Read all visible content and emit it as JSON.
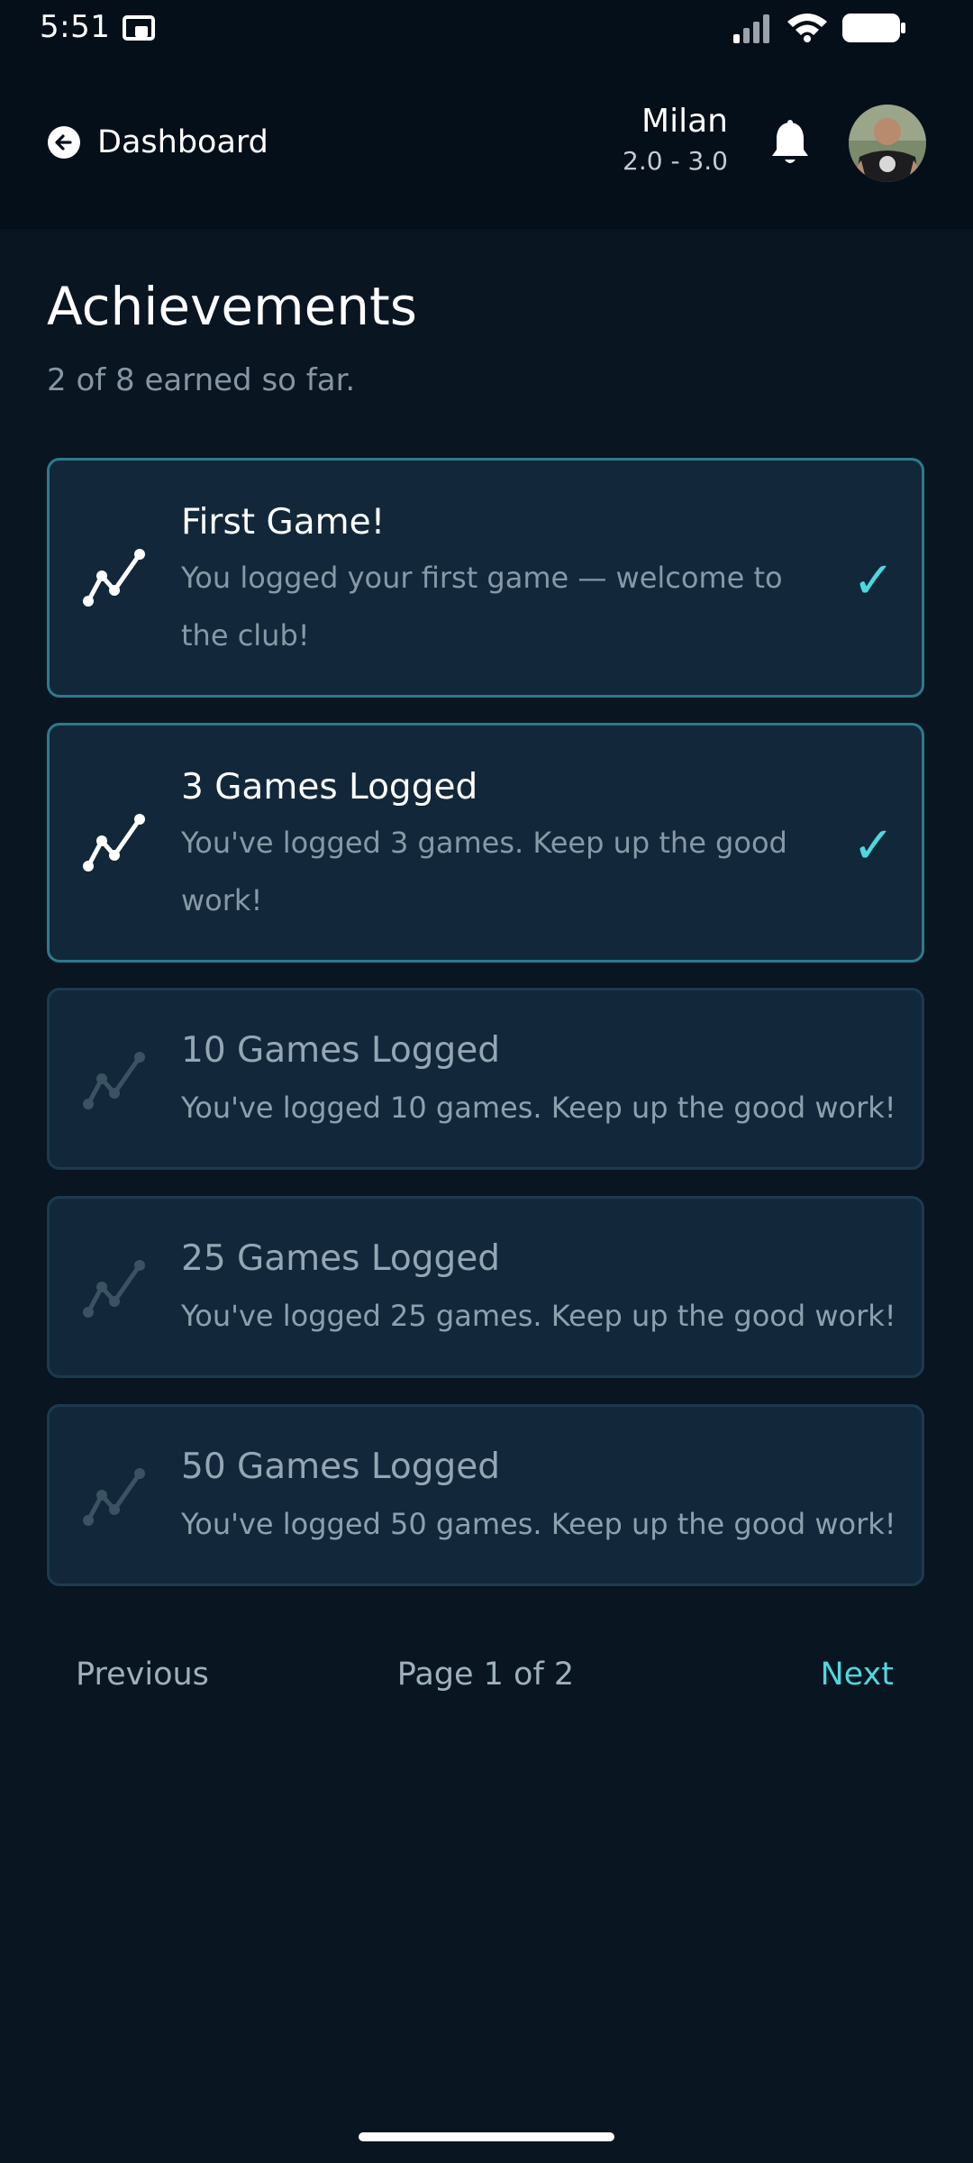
{
  "status_bar": {
    "time": "5:51",
    "icons": [
      "cast-icon",
      "signal-icon",
      "wifi-icon",
      "battery-icon"
    ]
  },
  "header": {
    "back_label": "Dashboard",
    "back_icon": "arrow-left-circle-icon",
    "user_name": "Milan",
    "user_level": "2.0 - 3.0",
    "bell_icon": "bell-icon"
  },
  "page": {
    "title": "Achievements",
    "subtitle": "2 of 8 earned so far."
  },
  "achievements": [
    {
      "title": "First Game!",
      "description": "You logged your first game — welcome to the club!",
      "earned": true,
      "icon": "trend-line-icon"
    },
    {
      "title": "3 Games Logged",
      "description": "You've logged 3 games. Keep up the good work!",
      "earned": true,
      "icon": "trend-line-icon"
    },
    {
      "title": "10 Games Logged",
      "description": "You've logged 10 games. Keep up the good work!",
      "earned": false,
      "icon": "trend-line-icon"
    },
    {
      "title": "25 Games Logged",
      "description": "You've logged 25 games. Keep up the good work!",
      "earned": false,
      "icon": "trend-line-icon"
    },
    {
      "title": "50 Games Logged",
      "description": "You've logged 50 games. Keep up the good work!",
      "earned": false,
      "icon": "trend-line-icon"
    }
  ],
  "check_mark": "✓",
  "pagination": {
    "previous_label": "Previous",
    "page_info": "Page 1 of 2",
    "next_label": "Next"
  },
  "colors": {
    "background": "#091521",
    "header": "#050f19",
    "card": "#12283a",
    "card_earned_border": "#2d7a8a",
    "accent": "#4fd7de"
  }
}
